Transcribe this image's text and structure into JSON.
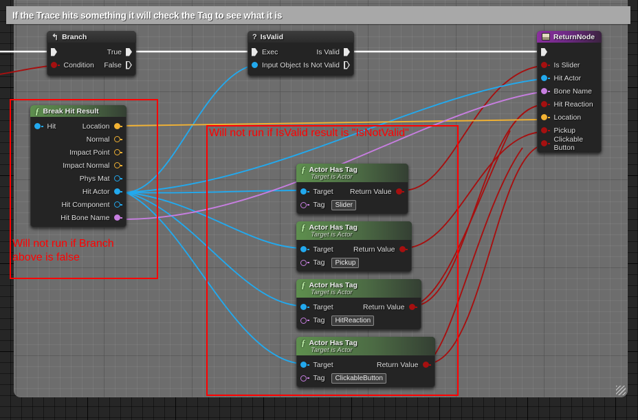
{
  "app": {
    "type": "blueprint-graph",
    "colors": {
      "exec_wire": "#ffffff",
      "bool_wire": "#a61010",
      "object_wire": "#22a9ee",
      "vector_wire": "#f2b233",
      "name_wire": "#c77ee0",
      "annotation": "#ff0000",
      "comment_bar": "#a8a8a8",
      "canvas": "#6d6d6d"
    }
  },
  "title_comment": {
    "text": "If the Trace hits something it will check the Tag to see what it is"
  },
  "nodes": {
    "branch": {
      "title": "Branch",
      "icon": "branch-icon",
      "inputs": [
        {
          "label": "",
          "type": "exec"
        },
        {
          "label": "Condition",
          "type": "bool"
        }
      ],
      "outputs": [
        {
          "label": "True",
          "type": "exec"
        },
        {
          "label": "False",
          "type": "exec"
        }
      ]
    },
    "isvalid": {
      "title": "IsValid",
      "icon": "question-icon",
      "inputs": [
        {
          "label": "Exec",
          "type": "exec"
        },
        {
          "label": "Input Object",
          "type": "object"
        }
      ],
      "outputs": [
        {
          "label": "Is Valid",
          "type": "exec"
        },
        {
          "label": "Is Not Valid",
          "type": "exec"
        }
      ]
    },
    "return_node": {
      "title": "ReturnNode",
      "icon": "return-node-icon",
      "inputs": [
        {
          "label": "",
          "type": "exec"
        },
        {
          "label": "Is Slider",
          "type": "bool"
        },
        {
          "label": "Hit Actor",
          "type": "object"
        },
        {
          "label": "Bone Name",
          "type": "name"
        },
        {
          "label": "Hit Reaction",
          "type": "bool"
        },
        {
          "label": "Location",
          "type": "vector"
        },
        {
          "label": "Pickup",
          "type": "bool"
        },
        {
          "label": "Clickable Button",
          "type": "bool"
        }
      ]
    },
    "break_hit_result": {
      "title": "Break Hit Result",
      "icon": "function-icon",
      "inputs": [
        {
          "label": "Hit",
          "type": "struct"
        }
      ],
      "outputs": [
        {
          "label": "Location",
          "type": "vector",
          "connected": true
        },
        {
          "label": "Normal",
          "type": "vector",
          "connected": false
        },
        {
          "label": "Impact Point",
          "type": "vector",
          "connected": false
        },
        {
          "label": "Impact Normal",
          "type": "vector",
          "connected": false
        },
        {
          "label": "Phys Mat",
          "type": "object",
          "connected": false
        },
        {
          "label": "Hit Actor",
          "type": "object",
          "connected": true
        },
        {
          "label": "Hit Component",
          "type": "object",
          "connected": false
        },
        {
          "label": "Hit Bone Name",
          "type": "name",
          "connected": true
        }
      ]
    },
    "actor_has_tag": [
      {
        "title": "Actor Has Tag",
        "subtitle": "Target is Actor",
        "icon": "function-icon",
        "target_label": "Target",
        "tag_label": "Tag",
        "tag_value": "Slider",
        "return_label": "Return Value"
      },
      {
        "title": "Actor Has Tag",
        "subtitle": "Target is Actor",
        "icon": "function-icon",
        "target_label": "Target",
        "tag_label": "Tag",
        "tag_value": "Pickup",
        "return_label": "Return Value"
      },
      {
        "title": "Actor Has Tag",
        "subtitle": "Target is Actor",
        "icon": "function-icon",
        "target_label": "Target",
        "tag_label": "Tag",
        "tag_value": "HitReaction",
        "return_label": "Return Value"
      },
      {
        "title": "Actor Has Tag",
        "subtitle": "Target is Actor",
        "icon": "function-icon",
        "target_label": "Target",
        "tag_label": "Tag",
        "tag_value": "ClickableButton",
        "return_label": "Return Value"
      }
    ]
  },
  "annotations": [
    {
      "id": "branch-annotation",
      "text": "Will not run if Branch\nabove is false"
    },
    {
      "id": "isvalid-annotation",
      "text": "Will not run if IsValid result is \"IsNotValid\""
    }
  ]
}
